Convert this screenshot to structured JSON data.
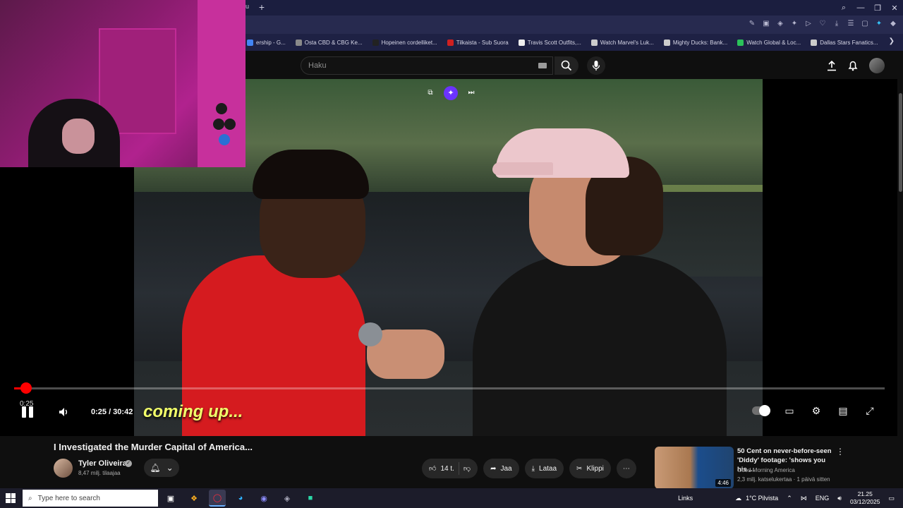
{
  "browser": {
    "tab_stub": "u",
    "bookmarks": [
      {
        "label": "ership - G...",
        "icon": "google-icon",
        "color": "#4285f4"
      },
      {
        "label": "Osta CBD & CBG Ke...",
        "icon": "globe-icon",
        "color": "#8a8a8a"
      },
      {
        "label": "Hopeinen cordelliket...",
        "icon": "kt-icon",
        "color": "#222222"
      },
      {
        "label": "Tilkaista - Sub Suora",
        "icon": "tv-icon",
        "color": "#d02020"
      },
      {
        "label": "Travis Scott Outfits,...",
        "icon": "page-icon",
        "color": "#eeeeee"
      },
      {
        "label": "Watch Marvel's Luk...",
        "icon": "swirl-icon",
        "color": "#cccccc"
      },
      {
        "label": "Mighty Ducks: Bank...",
        "icon": "lightning-icon",
        "color": "#cccccc"
      },
      {
        "label": "Watch Global & Loc...",
        "icon": "robot-icon",
        "color": "#2bc25a"
      },
      {
        "label": "Dallas Stars Fanatics...",
        "icon": "star-icon",
        "color": "#cccccc"
      }
    ],
    "more_bookmarks_icon": "chevron-right-icon"
  },
  "masthead": {
    "search_placeholder": "Haku"
  },
  "player": {
    "current_time": "0:25",
    "duration_text": "0:25 / 30:42",
    "progress_fraction": 0.0136,
    "subtitle": "coming up..."
  },
  "video": {
    "title": "I Investigated the Murder Capital of America...",
    "channel": "Tyler Oliveira",
    "subscribers": "8,47 milj. tilaajaa",
    "likes": "14 t.",
    "share_label": "Jaa",
    "download_label": "Lataa",
    "clip_label": "Klippi"
  },
  "recommendation": {
    "title": "50 Cent on never-before-seen 'Diddy' footage: 'shows you his ...",
    "channel": "Good Morning America",
    "meta": "2,3 milj. katselukertaa · 1 päivä sitten",
    "duration": "4:46"
  },
  "taskbar": {
    "search_placeholder": "Type here to search",
    "links": "Links",
    "weather": "1°C  Pilvista",
    "language": "ENG",
    "time": "21.25",
    "date": "03/12/2025"
  }
}
